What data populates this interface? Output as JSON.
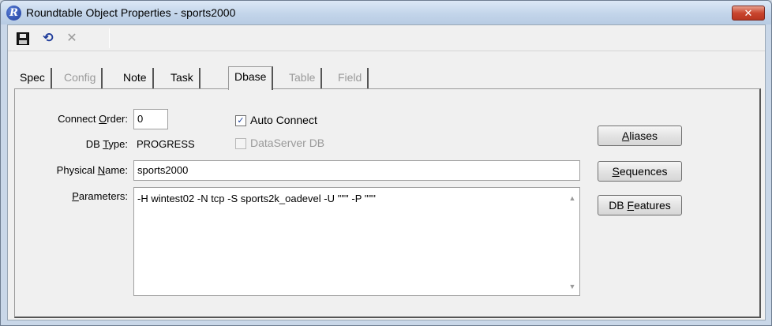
{
  "window": {
    "title": "Roundtable Object Properties - sports2000",
    "app_icon_letter": "R",
    "close_label": "✕"
  },
  "toolbar": {
    "buttons": [
      {
        "name": "save",
        "icon": "save-icon"
      },
      {
        "name": "undo",
        "icon": "undo-icon"
      },
      {
        "name": "delete",
        "icon": "delete-icon",
        "disabled": true
      }
    ]
  },
  "tabs": [
    {
      "label": "Spec",
      "enabled": true,
      "active": false
    },
    {
      "label": "Config",
      "enabled": false,
      "active": false
    },
    {
      "label": "Note",
      "enabled": true,
      "active": false
    },
    {
      "label": "Task",
      "enabled": true,
      "active": false
    },
    {
      "label": "Dbase",
      "enabled": true,
      "active": true
    },
    {
      "label": "Table",
      "enabled": false,
      "active": false
    },
    {
      "label": "Field",
      "enabled": false,
      "active": false
    }
  ],
  "form": {
    "connect_order": {
      "label_pre": "Connect ",
      "label_key": "O",
      "label_post": "rder:",
      "value": "0"
    },
    "db_type": {
      "label_pre": "DB ",
      "label_key": "T",
      "label_post": "ype:",
      "value": "PROGRESS"
    },
    "physical_name": {
      "label_pre": "Physical ",
      "label_key": "N",
      "label_post": "ame:",
      "value": "sports2000"
    },
    "parameters": {
      "label_pre": "",
      "label_key": "P",
      "label_post": "arameters:",
      "value": "-H wintest02 -N tcp -S sports2k_oadevel -U '\"\"' -P '\"\"'"
    },
    "auto_connect": {
      "label": "Auto Connect",
      "checked": true,
      "enabled": true
    },
    "dataserver_db": {
      "label": "DataServer DB",
      "checked": false,
      "enabled": false
    }
  },
  "buttons": {
    "aliases": {
      "pre": "",
      "key": "A",
      "post": "liases"
    },
    "sequences": {
      "pre": "",
      "key": "S",
      "post": "equences"
    },
    "db_features": {
      "pre": "DB ",
      "key": "F",
      "post": "eatures"
    }
  },
  "colors": {
    "title_bar": "#c3d5ea",
    "close_button": "#c9462f",
    "client_background": "#f0f0f0",
    "check_mark": "#1a3f99"
  }
}
